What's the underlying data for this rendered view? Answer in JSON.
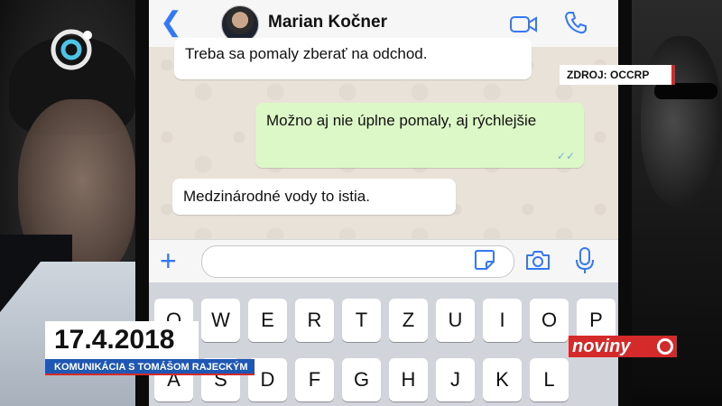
{
  "tv": {
    "source_label": "ZDROJ: OCCRP",
    "date": "17.4.2018",
    "caption": "KOMUNIKÁCIA S TOMÁŠOM RAJECKÝM",
    "brand": "noviny",
    "accent_color": "#d42a2a",
    "caption_color": "#1f58b4"
  },
  "chat": {
    "contact_name": "Marian Kočner",
    "messages": [
      {
        "direction": "incoming",
        "text": "Treba sa pomaly zberať na odchod."
      },
      {
        "direction": "outgoing",
        "text": "Možno aj nie úplne pomaly, aj rýchlejšie",
        "status": "read"
      },
      {
        "direction": "incoming",
        "text": "Medzinárodné vody to istia."
      }
    ],
    "icons": {
      "back": "chevron-left-icon",
      "video": "video-call-icon",
      "call": "phone-icon",
      "add": "plus-icon",
      "sticker": "sticker-icon",
      "camera": "camera-icon",
      "mic": "microphone-icon"
    }
  },
  "keyboard": {
    "row1": [
      "Q",
      "W",
      "E",
      "R",
      "T",
      "Z",
      "U",
      "I",
      "O",
      "P"
    ],
    "row2": [
      "A",
      "S",
      "D",
      "F",
      "G",
      "H",
      "J",
      "K",
      "L"
    ]
  }
}
